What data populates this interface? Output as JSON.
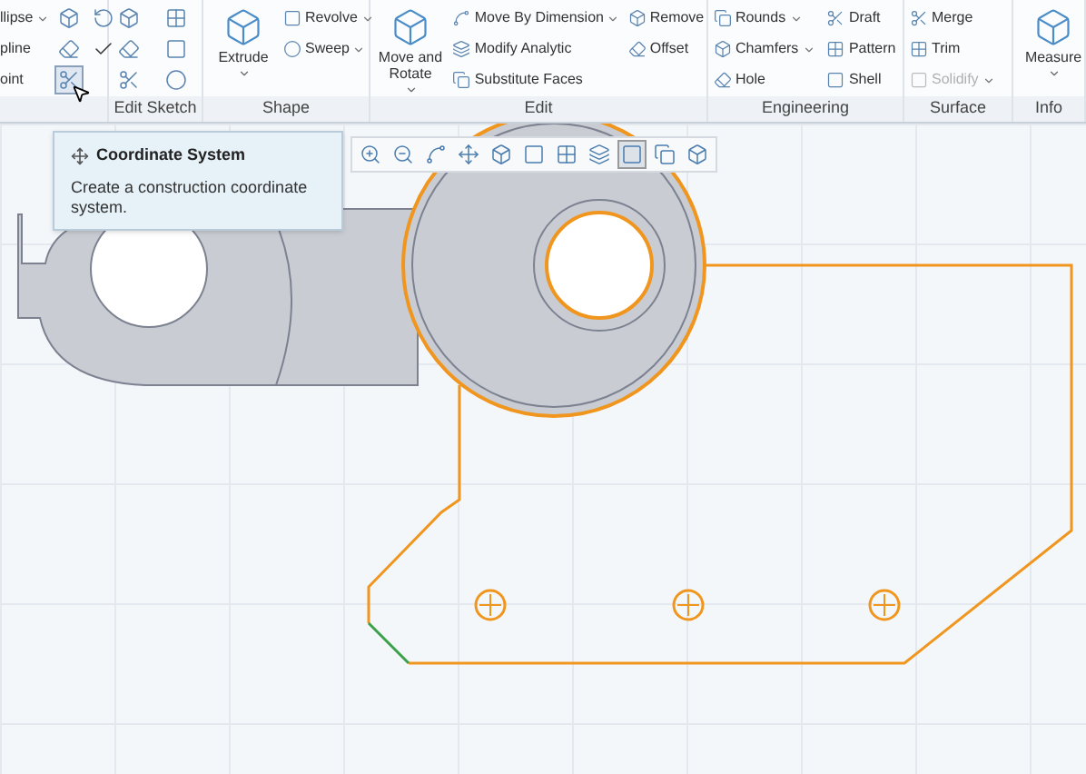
{
  "ribbon": {
    "groups": [
      {
        "items": [
          {
            "kind": "small",
            "label": "llipse",
            "menu": true
          },
          {
            "kind": "small",
            "label": "pline",
            "menu": false
          },
          {
            "kind": "small",
            "label": "oint",
            "menu": false
          },
          {
            "kind": "icon"
          },
          {
            "kind": "icon"
          },
          {
            "kind": "icon",
            "selected": true
          },
          {
            "kind": "icon"
          },
          {
            "kind": "icon"
          }
        ]
      },
      {
        "label": "Edit Sketch",
        "items": [
          {
            "kind": "icon"
          },
          {
            "kind": "icon"
          },
          {
            "kind": "icon"
          },
          {
            "kind": "icon"
          },
          {
            "kind": "icon"
          },
          {
            "kind": "icon"
          }
        ]
      },
      {
        "label": "Shape",
        "items": [
          {
            "kind": "large",
            "label": "Extrude",
            "menu": true
          },
          {
            "kind": "small",
            "label": "Revolve",
            "menu": true
          },
          {
            "kind": "small",
            "label": "Sweep",
            "menu": true
          }
        ]
      },
      {
        "label": "Edit",
        "items": [
          {
            "kind": "large",
            "label": "Move and Rotate",
            "menu": true
          },
          {
            "kind": "small",
            "label": "Move By Dimension",
            "menu": true
          },
          {
            "kind": "small",
            "label": "Modify Analytic",
            "menu": false
          },
          {
            "kind": "small",
            "label": "Substitute Faces",
            "menu": false
          },
          {
            "kind": "small",
            "label": "Remove",
            "menu": false
          },
          {
            "kind": "small",
            "label": "Offset",
            "menu": false
          }
        ]
      },
      {
        "label": "Engineering",
        "items": [
          {
            "kind": "small",
            "label": "Rounds",
            "menu": true
          },
          {
            "kind": "small",
            "label": "Chamfers",
            "menu": true
          },
          {
            "kind": "small",
            "label": "Hole",
            "menu": false
          },
          {
            "kind": "small",
            "label": "Draft",
            "menu": false
          },
          {
            "kind": "small",
            "label": "Pattern",
            "menu": false
          },
          {
            "kind": "small",
            "label": "Shell",
            "menu": false
          }
        ]
      },
      {
        "label": "Surface",
        "items": [
          {
            "kind": "small",
            "label": "Merge",
            "menu": false
          },
          {
            "kind": "small",
            "label": "Trim",
            "menu": false
          },
          {
            "kind": "small",
            "label": "Solidify",
            "menu": true,
            "disabled": true
          }
        ]
      },
      {
        "label": "Info",
        "items": [
          {
            "kind": "large",
            "label": "Measure",
            "menu": true
          }
        ]
      }
    ]
  },
  "tooltip": {
    "title": "Coordinate System",
    "text": "Create a construction coordinate system."
  }
}
